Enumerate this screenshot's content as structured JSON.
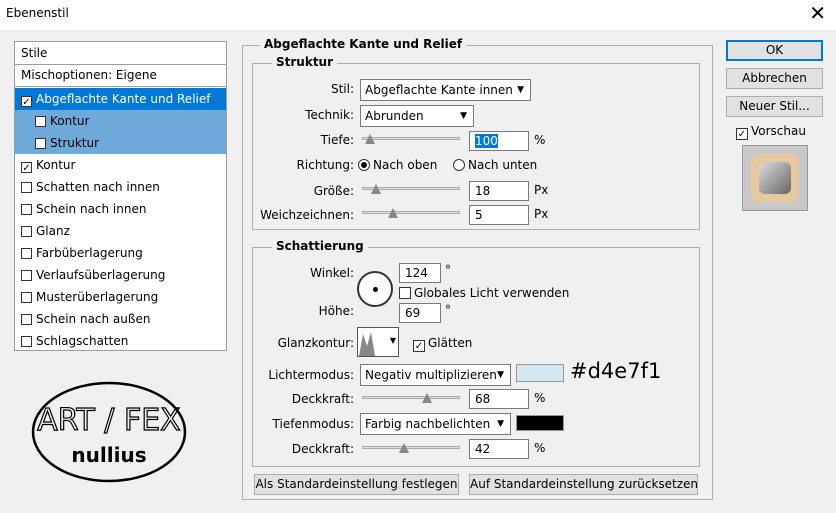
{
  "window": {
    "title": "Ebenenstil",
    "close_glyph": "✕"
  },
  "sidebar": {
    "header": "Stile",
    "blend_options": "Mischoptionen: Eigene",
    "items": [
      {
        "label": "Abgeflachte Kante und Relief",
        "checked": true
      },
      {
        "label": "Kontur",
        "checked": false
      },
      {
        "label": "Struktur",
        "checked": false
      },
      {
        "label": "Kontur",
        "checked": true
      },
      {
        "label": "Schatten nach innen",
        "checked": false
      },
      {
        "label": "Schein nach innen",
        "checked": false
      },
      {
        "label": "Glanz",
        "checked": false
      },
      {
        "label": "Farbüberlagerung",
        "checked": false
      },
      {
        "label": "Verlaufsüberlagerung",
        "checked": false
      },
      {
        "label": "Musterüberlagerung",
        "checked": false
      },
      {
        "label": "Schein nach außen",
        "checked": false
      },
      {
        "label": "Schlagschatten",
        "checked": false
      }
    ],
    "check_glyph": "✓"
  },
  "logo": {
    "text_top": "ART / FEX",
    "text_bottom": "nullius"
  },
  "main": {
    "section_title": "Abgeflachte Kante und Relief",
    "structure": {
      "title": "Struktur",
      "style_label": "Stil:",
      "style_value": "Abgeflachte Kante innen",
      "technique_label": "Technik:",
      "technique_value": "Abrunden",
      "depth_label": "Tiefe:",
      "depth_value": "100",
      "depth_unit": "%",
      "direction_label": "Richtung:",
      "direction_up": "Nach oben",
      "direction_down": "Nach unten",
      "size_label": "Größe:",
      "size_value": "18",
      "size_unit": "Px",
      "soften_label": "Weichzeichnen:",
      "soften_value": "5",
      "soften_unit": "Px"
    },
    "shading": {
      "title": "Schattierung",
      "angle_label": "Winkel:",
      "angle_value": "124",
      "angle_unit": "°",
      "global_light_label": "Globales Licht verwenden",
      "altitude_label": "Höhe:",
      "altitude_value": "69",
      "altitude_unit": "°",
      "gloss_label": "Glanzkontur:",
      "antialias_label": "Glätten",
      "highlight_mode_label": "Lichtermodus:",
      "highlight_mode_value": "Negativ multiplizieren",
      "highlight_color": "#d4e7f1",
      "highlight_color_label": "#d4e7f1",
      "opacity1_label": "Deckkraft:",
      "opacity1_value": "68",
      "opacity1_unit": "%",
      "shadow_mode_label": "Tiefenmodus:",
      "shadow_mode_value": "Farbig nachbelichten",
      "shadow_color": "#000000",
      "opacity2_label": "Deckkraft:",
      "opacity2_value": "42",
      "opacity2_unit": "%"
    },
    "make_default": "Als Standardeinstellung festlegen",
    "reset_default": "Auf Standardeinstellung zurücksetzen"
  },
  "right": {
    "ok": "OK",
    "cancel": "Abbrechen",
    "new_style": "Neuer Stil...",
    "preview_label": "Vorschau"
  },
  "sliders": {
    "depth": 0.03,
    "size": 0.1,
    "soften": 0.3,
    "opacity1": 0.68,
    "opacity2": 0.42
  }
}
